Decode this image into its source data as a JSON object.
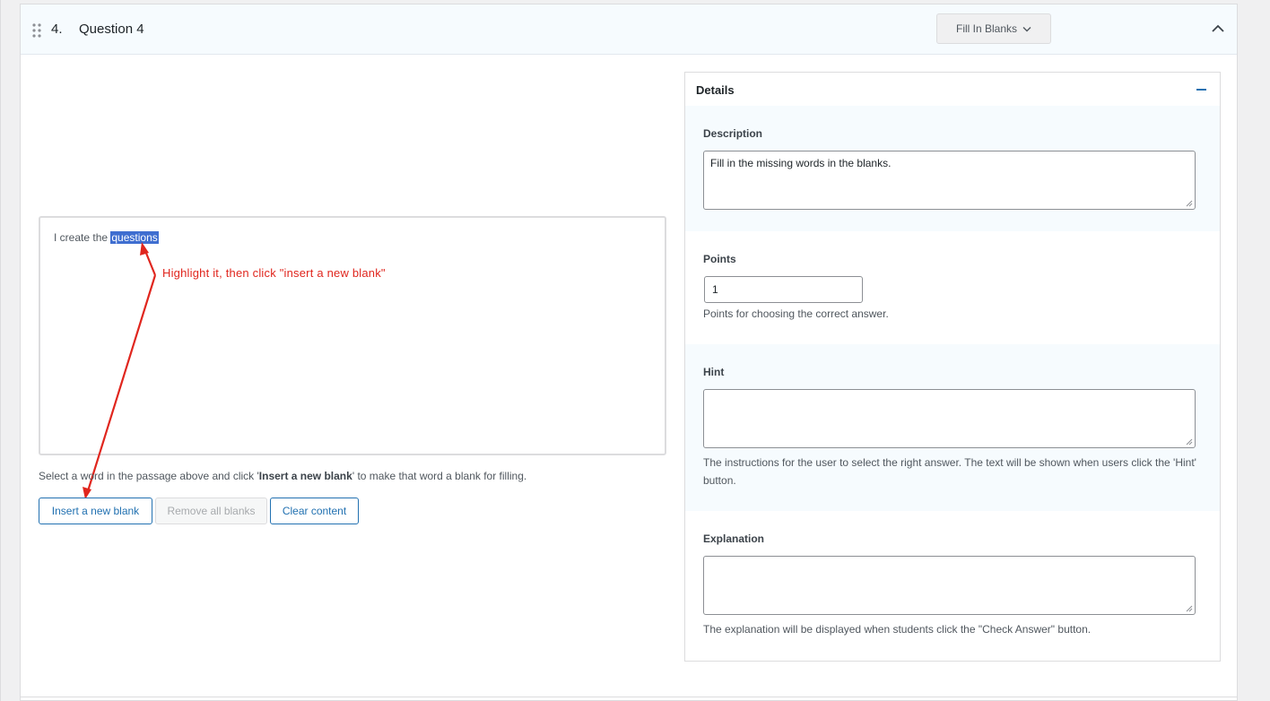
{
  "question": {
    "number": "4.",
    "title": "Question 4",
    "type_label": "Fill In Blanks"
  },
  "editor": {
    "text_before": "I create the ",
    "selected_word": "questions",
    "annotation": "Highlight it, then click \"insert a new blank\""
  },
  "help": {
    "prefix": "Select a word in the passage above and click '",
    "bold": "Insert a new blank",
    "suffix": "' to make that word a blank for filling."
  },
  "buttons": {
    "insert_label": "Insert a new blank",
    "remove_label": "Remove all blanks",
    "clear_label": "Clear content"
  },
  "details": {
    "title": "Details",
    "description": {
      "label": "Description",
      "value": "Fill in the missing words in the blanks."
    },
    "points": {
      "label": "Points",
      "value": "1",
      "help": "Points for choosing the correct answer."
    },
    "hint": {
      "label": "Hint",
      "value": "",
      "help": "The instructions for the user to select the right answer. The text will be shown when users click the 'Hint' button."
    },
    "explanation": {
      "label": "Explanation",
      "value": "",
      "help": "The explanation will be displayed when students click the \"Check Answer\" button."
    }
  },
  "colors": {
    "accent": "#2271b1",
    "annotation": "#e0261e",
    "selection": "#3f6ed0",
    "header_bg": "#f6fbfe"
  }
}
